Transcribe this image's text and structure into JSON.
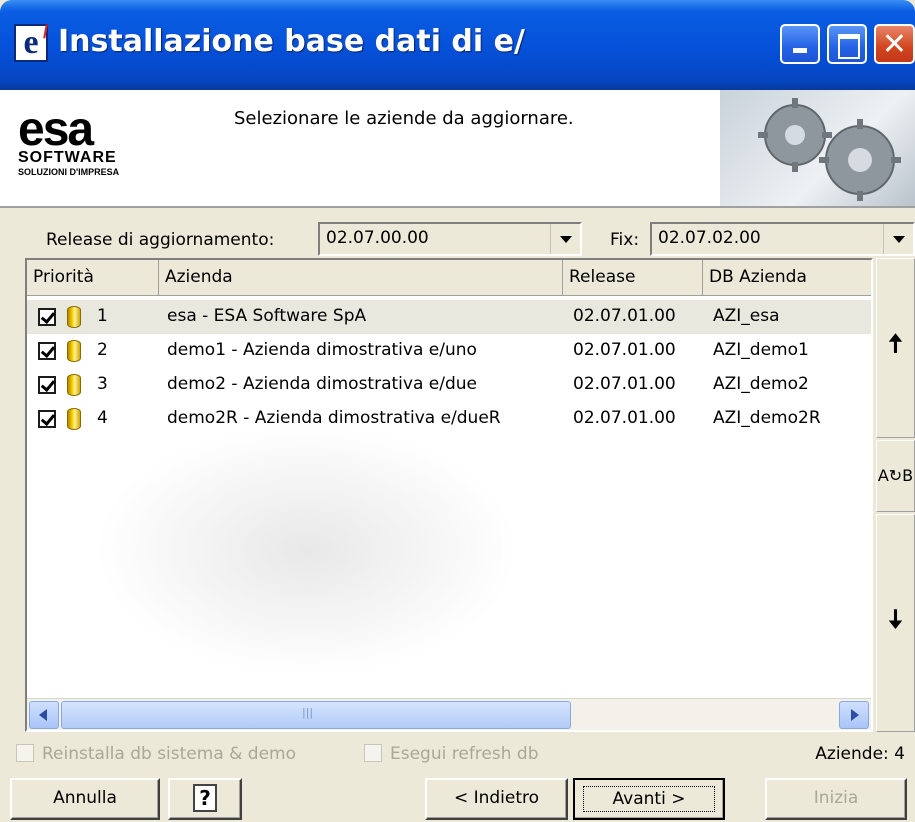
{
  "window": {
    "title": "Installazione base dati di e/",
    "icon_letter": "e",
    "icon_mark": "/"
  },
  "header": {
    "logo_main": "esa",
    "logo_software": "SOFTWARE",
    "logo_tagline": "SOLUZIONI D'IMPRESA",
    "instruction": "Selezionare le aziende da aggiornare."
  },
  "release": {
    "label": "Release di aggiornamento:",
    "value": "02.07.00.00",
    "fix_label": "Fix:",
    "fix_value": "02.07.02.00"
  },
  "table": {
    "columns": [
      "Priorità",
      "Azienda",
      "Release",
      "DB Azienda"
    ],
    "rows": [
      {
        "checked": true,
        "priority": "1",
        "azienda": "esa - ESA Software SpA",
        "release": "02.07.01.00",
        "db": "AZI_esa"
      },
      {
        "checked": true,
        "priority": "2",
        "azienda": "demo1 - Azienda dimostrativa e/uno",
        "release": "02.07.01.00",
        "db": "AZI_demo1"
      },
      {
        "checked": true,
        "priority": "3",
        "azienda": "demo2 - Azienda dimostrativa e/due",
        "release": "02.07.01.00",
        "db": "AZI_demo2"
      },
      {
        "checked": true,
        "priority": "4",
        "azienda": "demo2R - Azienda dimostrativa e/dueR",
        "release": "02.07.01.00",
        "db": "AZI_demo2R"
      }
    ]
  },
  "side": {
    "up_glyph": "🠅",
    "sort_glyph": "A↻B",
    "down_glyph": "🠇"
  },
  "options": {
    "reinstall": "Reinstalla db sistema & demo",
    "refresh": "Esegui refresh db",
    "count": "Aziende: 4"
  },
  "buttons": {
    "cancel": "Annulla",
    "help": "?",
    "back": "< Indietro",
    "next": "Avanti >",
    "start": "Inizia"
  }
}
